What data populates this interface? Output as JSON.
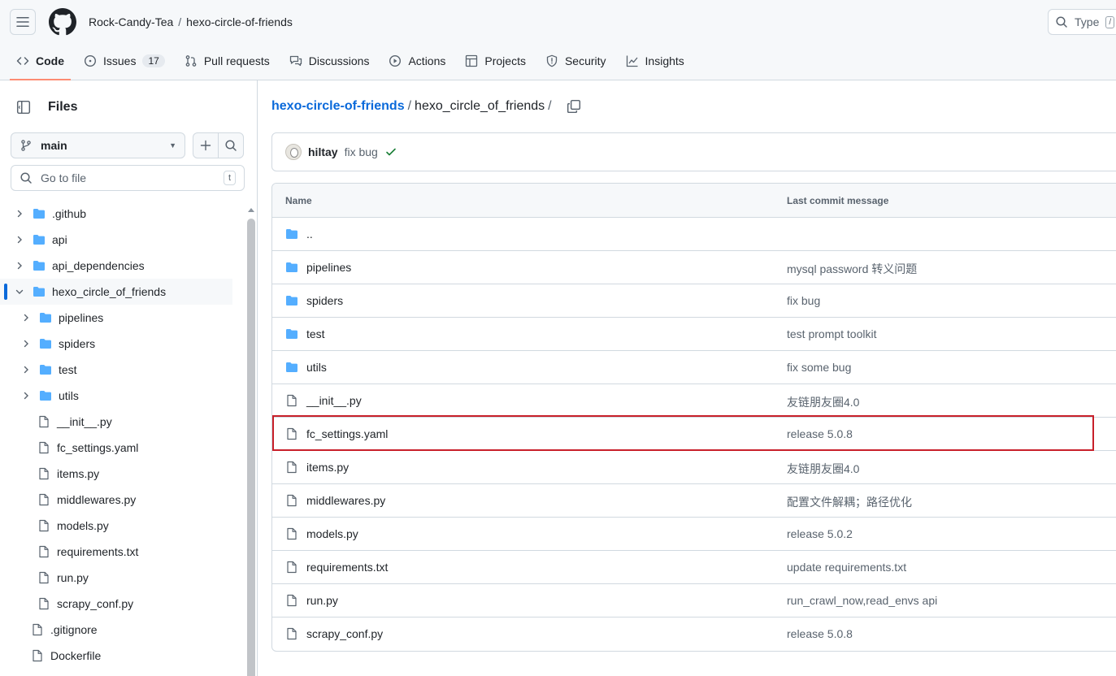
{
  "header": {
    "owner": "Rock-Candy-Tea",
    "separator": "/",
    "repo": "hexo-circle-of-friends",
    "search_text": "Type",
    "search_key": "/"
  },
  "nav": {
    "code": "Code",
    "issues": "Issues",
    "issues_count": "17",
    "pull_requests": "Pull requests",
    "discussions": "Discussions",
    "actions": "Actions",
    "projects": "Projects",
    "security": "Security",
    "insights": "Insights"
  },
  "sidebar": {
    "title": "Files",
    "branch": "main",
    "goto_placeholder": "Go to file",
    "goto_key": "t",
    "tree": [
      {
        "label": ".github",
        "type": "folder",
        "depth": 0,
        "expanded": false
      },
      {
        "label": "api",
        "type": "folder",
        "depth": 0,
        "expanded": false
      },
      {
        "label": "api_dependencies",
        "type": "folder",
        "depth": 0,
        "expanded": false
      },
      {
        "label": "hexo_circle_of_friends",
        "type": "folder",
        "depth": 0,
        "expanded": true,
        "selected": true
      },
      {
        "label": "pipelines",
        "type": "folder",
        "depth": 1,
        "expanded": false
      },
      {
        "label": "spiders",
        "type": "folder",
        "depth": 1,
        "expanded": false
      },
      {
        "label": "test",
        "type": "folder",
        "depth": 1,
        "expanded": false
      },
      {
        "label": "utils",
        "type": "folder",
        "depth": 1,
        "expanded": false
      },
      {
        "label": "__init__.py",
        "type": "file",
        "depth": 1
      },
      {
        "label": "fc_settings.yaml",
        "type": "file",
        "depth": 1
      },
      {
        "label": "items.py",
        "type": "file",
        "depth": 1
      },
      {
        "label": "middlewares.py",
        "type": "file",
        "depth": 1
      },
      {
        "label": "models.py",
        "type": "file",
        "depth": 1
      },
      {
        "label": "requirements.txt",
        "type": "file",
        "depth": 1
      },
      {
        "label": "run.py",
        "type": "file",
        "depth": 1
      },
      {
        "label": "scrapy_conf.py",
        "type": "file",
        "depth": 1
      },
      {
        "label": ".gitignore",
        "type": "file",
        "depth": 0
      },
      {
        "label": "Dockerfile",
        "type": "file",
        "depth": 0
      }
    ]
  },
  "main": {
    "path_root": "hexo-circle-of-friends",
    "path_sep": "/",
    "path_current": "hexo_circle_of_friends",
    "path_trailing": "/",
    "commit": {
      "author": "hiltay",
      "message": "fix bug"
    },
    "table": {
      "col_name": "Name",
      "col_message": "Last commit message",
      "rows": [
        {
          "name": "..",
          "type": "folder",
          "message": ""
        },
        {
          "name": "pipelines",
          "type": "folder",
          "message": "mysql password 转义问题"
        },
        {
          "name": "spiders",
          "type": "folder",
          "message": "fix bug"
        },
        {
          "name": "test",
          "type": "folder",
          "message": "test prompt toolkit"
        },
        {
          "name": "utils",
          "type": "folder",
          "message": "fix some bug"
        },
        {
          "name": "__init__.py",
          "type": "file",
          "message": "友链朋友圈4.0"
        },
        {
          "name": "fc_settings.yaml",
          "type": "file",
          "message": "release 5.0.8",
          "highlighted": true
        },
        {
          "name": "items.py",
          "type": "file",
          "message": "友链朋友圈4.0"
        },
        {
          "name": "middlewares.py",
          "type": "file",
          "message": "配置文件解耦；路径优化"
        },
        {
          "name": "models.py",
          "type": "file",
          "message": "release 5.0.2"
        },
        {
          "name": "requirements.txt",
          "type": "file",
          "message": "update requirements.txt"
        },
        {
          "name": "run.py",
          "type": "file",
          "message": "run_crawl_now,read_envs api"
        },
        {
          "name": "scrapy_conf.py",
          "type": "file",
          "message": "release 5.0.8"
        }
      ]
    }
  },
  "colors": {
    "link": "#0969da",
    "folder": "#54aeff",
    "highlight": "#c8202a",
    "check": "#1a7f37",
    "active_tab": "#fd8c73"
  }
}
